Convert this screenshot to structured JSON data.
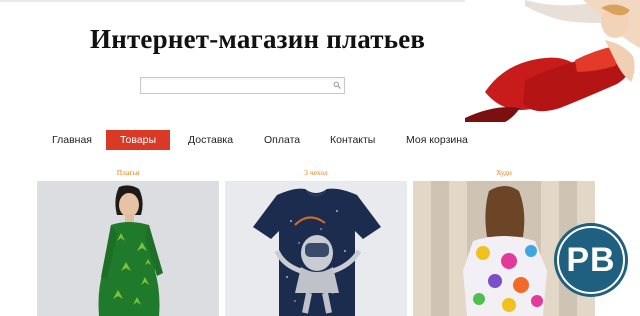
{
  "header": {
    "title": "Интернет-магазин платьев",
    "search": {
      "value": "",
      "placeholder": ""
    }
  },
  "nav": {
    "items": [
      {
        "label": "Главная",
        "active": false
      },
      {
        "label": "Товары",
        "active": true
      },
      {
        "label": "Доставка",
        "active": false
      },
      {
        "label": "Оплата",
        "active": false
      },
      {
        "label": "Контакты",
        "active": false
      },
      {
        "label": "Моя корзина",
        "active": false
      }
    ]
  },
  "products": [
    {
      "category": "Платья"
    },
    {
      "category": "3 чехол"
    },
    {
      "category": "Худи"
    }
  ],
  "badge": {
    "text": "PB"
  },
  "colors": {
    "accent": "#d93a26",
    "category_text": "#e0831f",
    "badge": "#1f5f7f"
  },
  "icons": {
    "search": "search-icon"
  }
}
